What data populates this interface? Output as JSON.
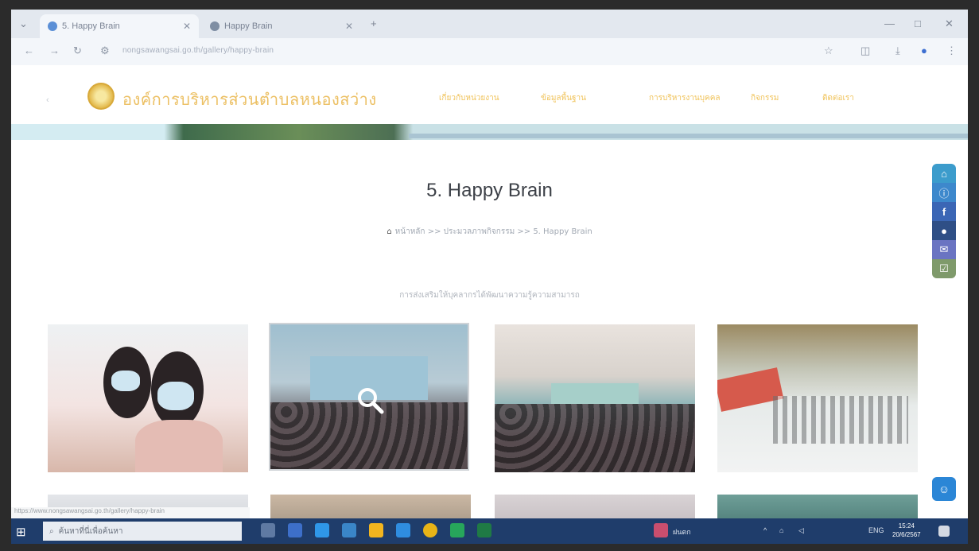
{
  "browser": {
    "tabs": [
      {
        "label": "5. Happy Brain",
        "active": true
      },
      {
        "label": "Happy Brain",
        "active": false
      }
    ],
    "new_tab": "+",
    "url": "nongsawangsai.go.th/gallery/happy-brain",
    "window_controls": {
      "minimize": "—",
      "maximize": "□",
      "close": "✕"
    }
  },
  "site": {
    "title": "องค์การบริหารส่วนตำบลหนองสว่าง",
    "menu": [
      "เกี่ยวกับหน่วยงาน",
      "ข้อมูลพื้นฐาน",
      "การบริหารงานบุคคล",
      "กิจกรรม",
      "ติดต่อเรา"
    ]
  },
  "page": {
    "title": "5. Happy Brain",
    "breadcrumb": {
      "home": "หน้าหลัก",
      "separator": ">>",
      "parent": "ประมวลภาพกิจกรรม",
      "current": "5. Happy Brain"
    },
    "caption": "การส่งเสริมให้บุคลากรได้พัฒนาความรู้ความสามารถ"
  },
  "floating_icons": [
    {
      "name": "home-icon",
      "glyph": "⌂",
      "color": "#3c9ccc"
    },
    {
      "name": "info-icon",
      "glyph": "ⓘ",
      "color": "#3d88cc"
    },
    {
      "name": "facebook-icon",
      "glyph": "f",
      "color": "#3b66b5"
    },
    {
      "name": "user-icon",
      "glyph": "●",
      "color": "#2f4f86"
    },
    {
      "name": "mail-icon",
      "glyph": "✉",
      "color": "#6a74c2"
    },
    {
      "name": "checklist-icon",
      "glyph": "☑",
      "color": "#7f9a6b"
    }
  ],
  "status_strip": "https://www.nongsawangsai.go.th/gallery/happy-brain",
  "taskbar": {
    "search_placeholder": "ค้นหาที่นี่เพื่อค้นหา",
    "weather": "ฝนตก",
    "network": "ENG",
    "time": "15:24",
    "date": "20/6/2567"
  }
}
